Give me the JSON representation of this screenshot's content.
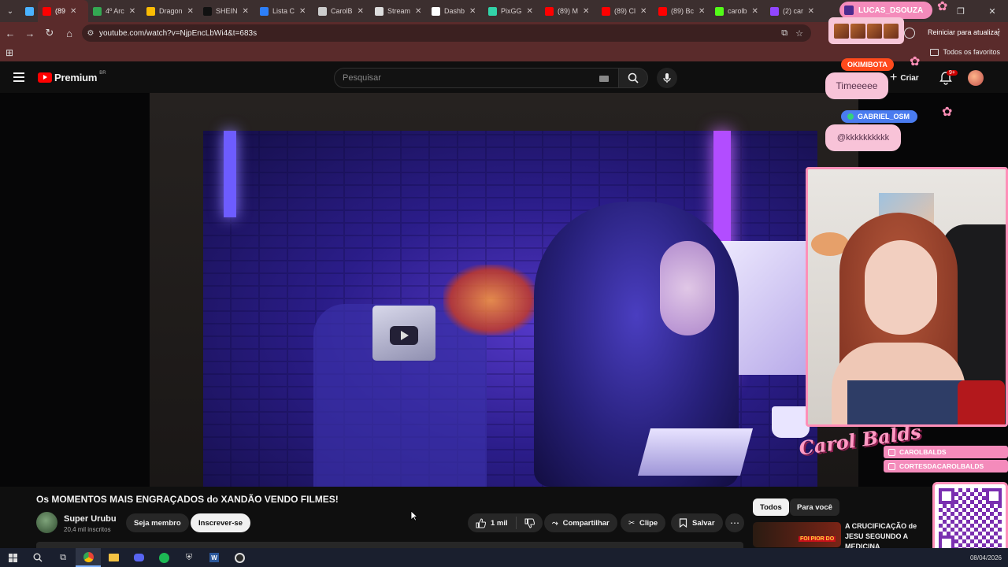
{
  "browser": {
    "tabs": [
      {
        "label": "",
        "color": "#4ab3ff",
        "active": false
      },
      {
        "label": "(89",
        "color": "#ff0000",
        "active": true
      },
      {
        "label": "4º Arc",
        "color": "#33a852",
        "active": false
      },
      {
        "label": "Dragon",
        "color": "#fbbc04",
        "active": false
      },
      {
        "label": "SHEIN",
        "color": "#111111",
        "active": false
      },
      {
        "label": "Lista C",
        "color": "#2d7ff9",
        "active": false
      },
      {
        "label": "CarolB",
        "color": "#cccccc",
        "active": false
      },
      {
        "label": "Stream",
        "color": "#dddddd",
        "active": false
      },
      {
        "label": "Dashb",
        "color": "#ffffff",
        "active": false
      },
      {
        "label": "PixGG",
        "color": "#32d3a8",
        "active": false
      },
      {
        "label": "(89) M",
        "color": "#ff0000",
        "active": false
      },
      {
        "label": "(89) Cl",
        "color": "#ff0000",
        "active": false
      },
      {
        "label": "(89) Bc",
        "color": "#ff0000",
        "active": false
      },
      {
        "label": "carolb",
        "color": "#53fc18",
        "active": false
      },
      {
        "label": "(2) car",
        "color": "#9146ff",
        "active": false
      }
    ],
    "url": "youtube.com/watch?v=NjpEncLbWi4&t=683s",
    "update_label": "Reiniciar para atualizar",
    "bookmarks_all": "Todos os favoritos"
  },
  "youtube": {
    "logo_text": "Premium",
    "country_code": "BR",
    "search_placeholder": "Pesquisar",
    "create_label": "Criar",
    "notif_count": "9+"
  },
  "video": {
    "title": "Os MOMENTOS MAIS ENGRAÇADOS do XANDÃO VENDO FILMES!",
    "channel": "Super Urubu",
    "subscribers": "20,4 mil inscritos",
    "member_label": "Seja membro",
    "subscribe_label": "Inscrever-se",
    "likes": "1 mil",
    "share_label": "Compartilhar",
    "clip_label": "Clipe",
    "save_label": "Salvar"
  },
  "recommendations": {
    "chips": [
      "Todos",
      "Para você"
    ],
    "first_title": "A CRUCIFICAÇÃO de JESU SEGUNDO A MEDICINA",
    "first_thumb_text": "FOI PIOR DO"
  },
  "stream_overlay": {
    "chat": [
      {
        "user": "LUCAS_DSOUZA",
        "message": ""
      },
      {
        "user": "OKIMIBOTA",
        "message": "Timeeeee"
      },
      {
        "user": "GABRIEL_OSM",
        "message": "@kkkkkkkkkk"
      }
    ],
    "brand_name": "Carol Balds",
    "socials": [
      "CAROLBALDS",
      "CORTESDACAROLBALDS"
    ]
  },
  "taskbar": {
    "date": "08/04/2026"
  }
}
